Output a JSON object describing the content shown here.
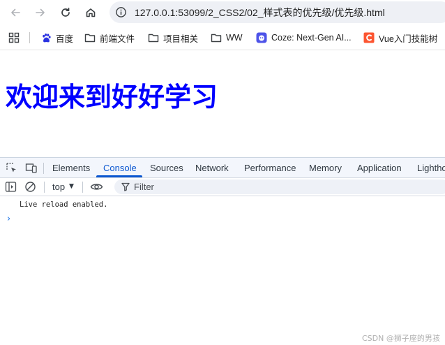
{
  "browser": {
    "url": "127.0.0.1:53099/2_CSS2/02_样式表的优先级/优先级.html",
    "bookmarks": [
      {
        "label": "百度",
        "icon": "baidu-paw-icon"
      },
      {
        "label": "前端文件",
        "icon": "folder-icon"
      },
      {
        "label": "项目相关",
        "icon": "folder-icon"
      },
      {
        "label": "WW",
        "icon": "folder-icon"
      },
      {
        "label": "Coze: Next-Gen AI...",
        "icon": "coze-icon"
      },
      {
        "label": "Vue入门技能树",
        "icon": "csdn-c-icon"
      }
    ]
  },
  "page": {
    "heading": "欢迎来到好好学习",
    "heading_color": "#0000ff"
  },
  "devtools": {
    "tabs": [
      "Elements",
      "Console",
      "Sources",
      "Network",
      "Performance",
      "Memory",
      "Application",
      "Lighthouse"
    ],
    "active_tab": "Console",
    "context": "top",
    "filter_placeholder": "Filter",
    "logs": [
      "Live reload enabled."
    ],
    "prompt_symbol": "›",
    "accent_color": "#0b57d0"
  },
  "watermark": "CSDN @狮子座的男孩"
}
